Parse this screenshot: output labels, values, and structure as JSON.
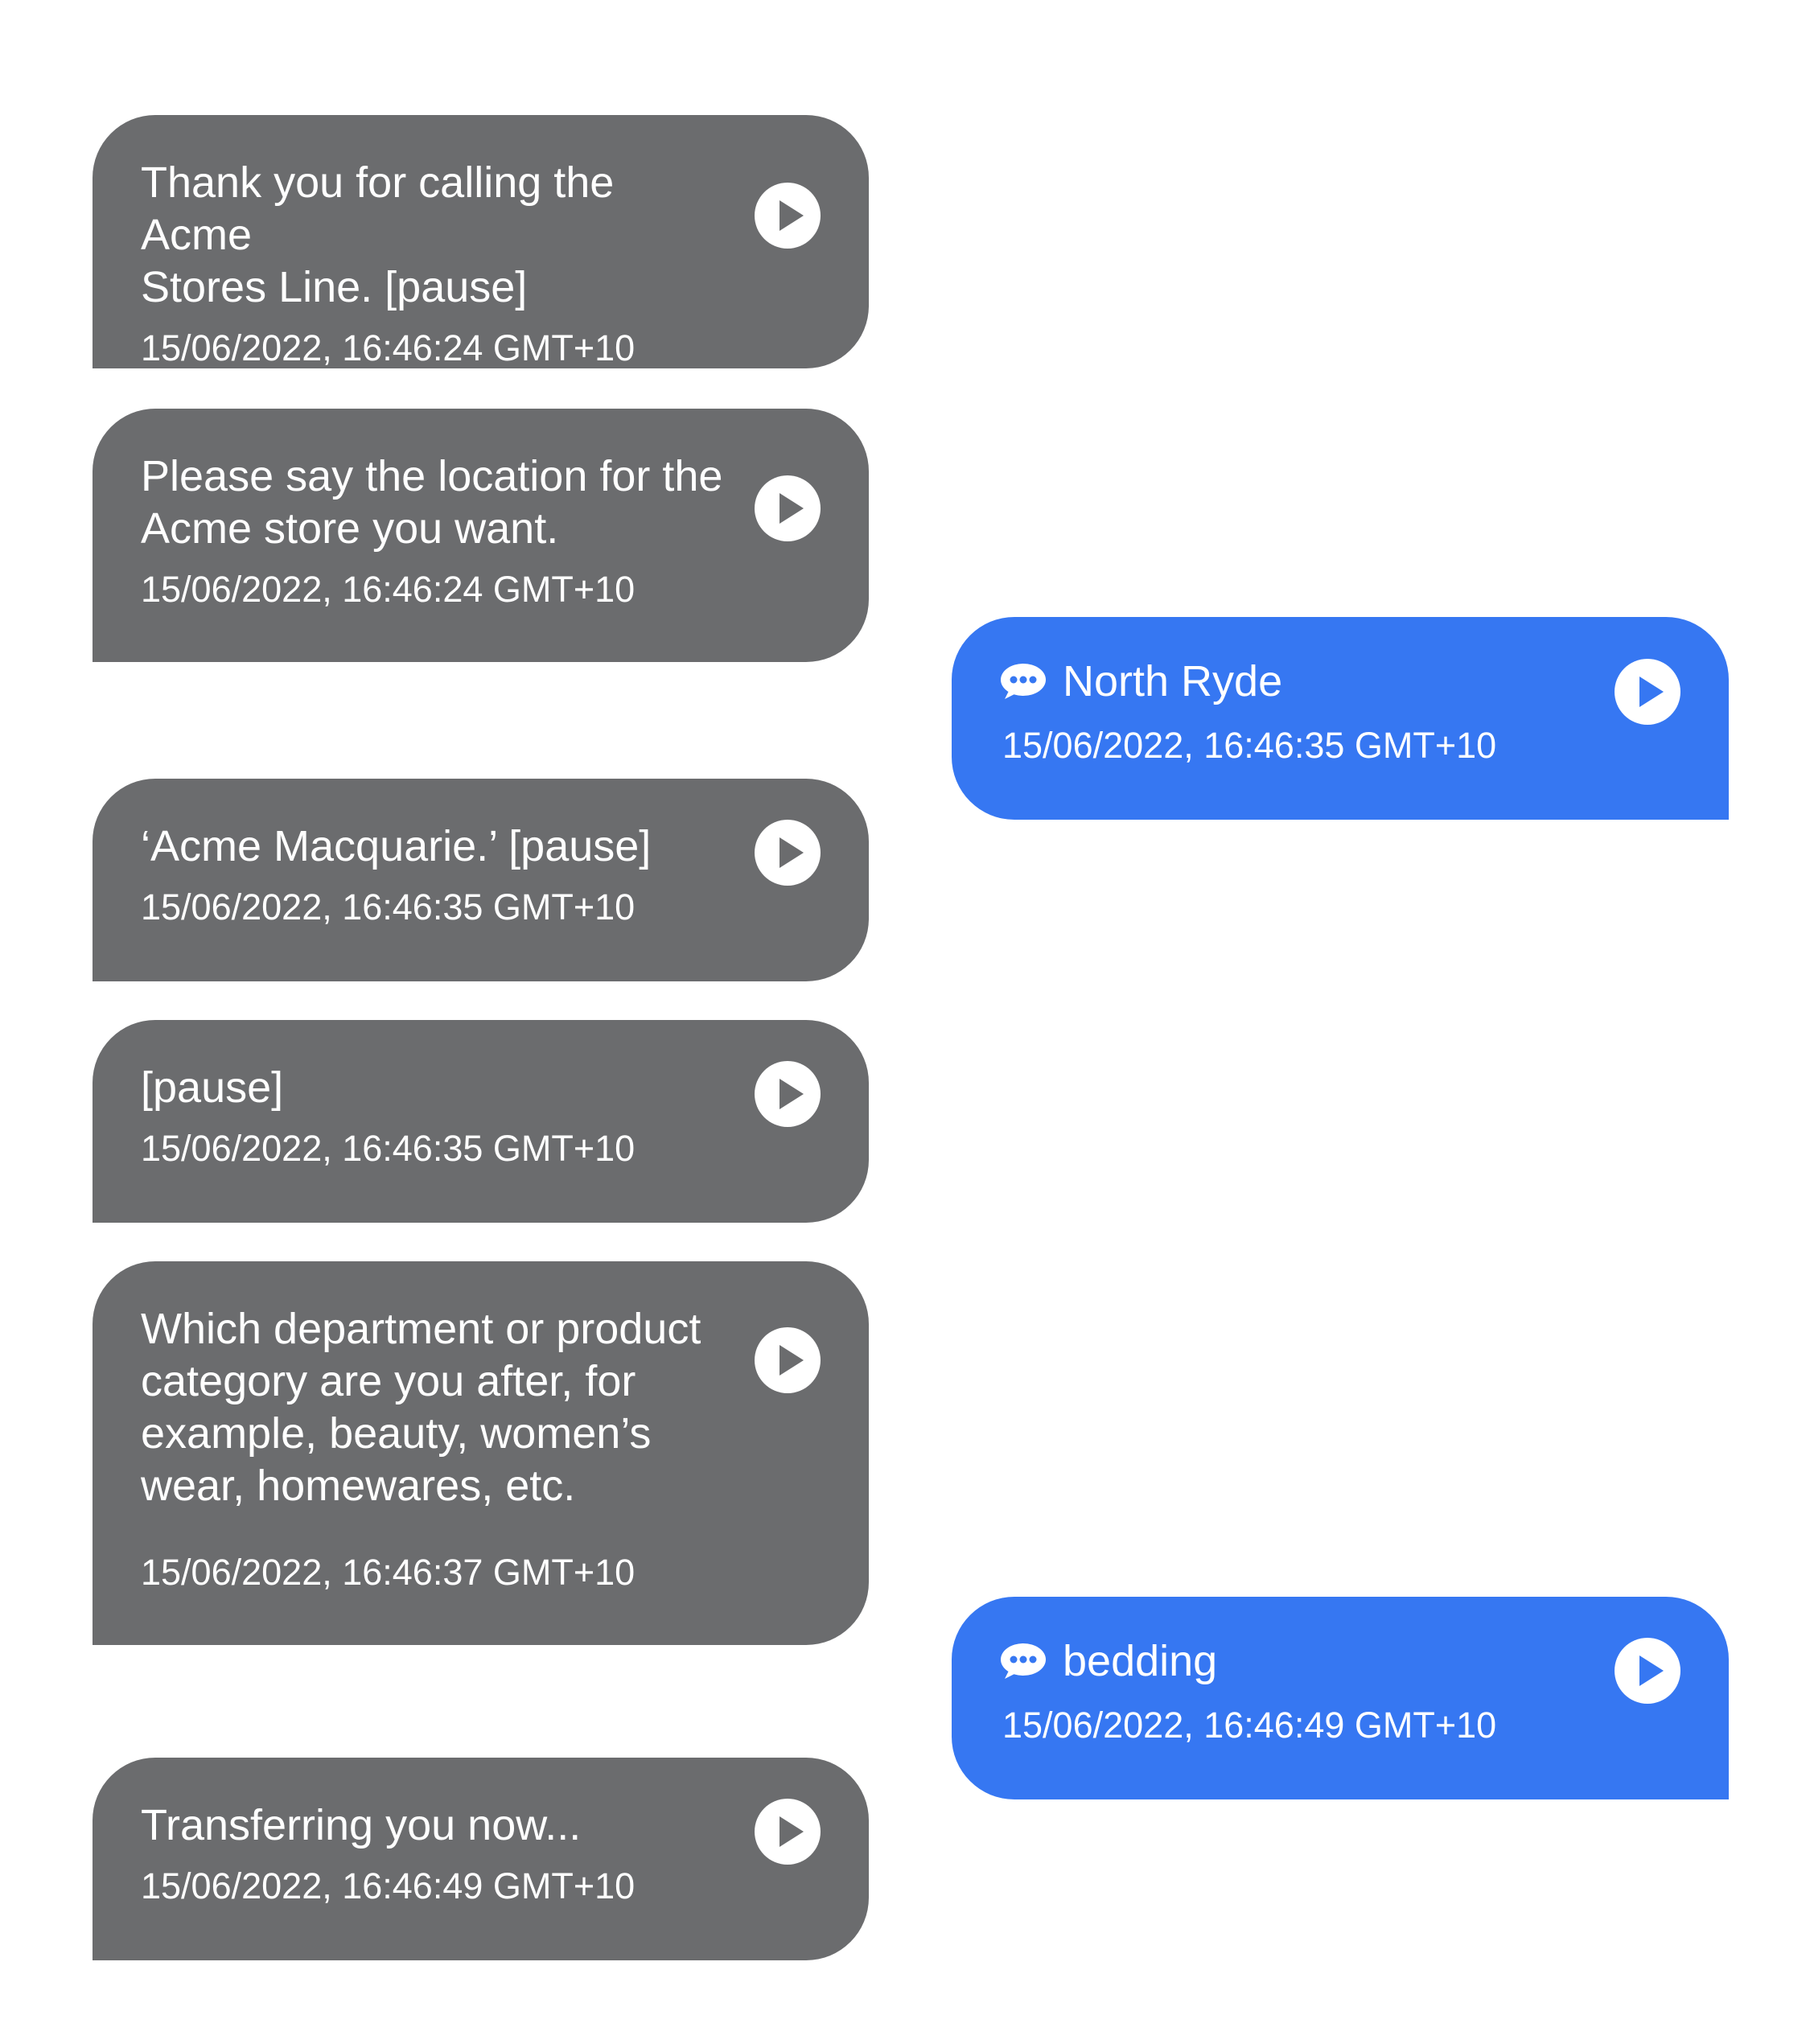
{
  "colors": {
    "bot_bubble": "#6b6c6e",
    "user_bubble": "#3677f2",
    "text": "#ffffff",
    "background": "#ffffff"
  },
  "icons": {
    "play": "play-icon",
    "speech": "speech-bubble-icon"
  },
  "messages": [
    {
      "sender": "bot",
      "text": "Thank you for calling the Acme\nStores Line. [pause]",
      "time": "15/06/2022, 16:46:24 GMT+10"
    },
    {
      "sender": "bot",
      "text": "Please say the location for the\nAcme store you want.",
      "time": "15/06/2022, 16:46:24 GMT+10"
    },
    {
      "sender": "user",
      "text": "North Ryde",
      "time": "15/06/2022, 16:46:35 GMT+10"
    },
    {
      "sender": "bot",
      "text": "‘Acme Macquarie.’ [pause]",
      "time": "15/06/2022, 16:46:35 GMT+10"
    },
    {
      "sender": "bot",
      "text": "[pause]",
      "time": "15/06/2022, 16:46:35 GMT+10"
    },
    {
      "sender": "bot",
      "text": "Which department or product\ncategory are you after, for\nexample, beauty, women’s\nwear, homewares, etc.",
      "time": "15/06/2022, 16:46:37 GMT+10"
    },
    {
      "sender": "user",
      "text": "bedding",
      "time": "15/06/2022, 16:46:49 GMT+10"
    },
    {
      "sender": "bot",
      "text": "Transferring you now...",
      "time": "15/06/2022, 16:46:49 GMT+10"
    }
  ]
}
